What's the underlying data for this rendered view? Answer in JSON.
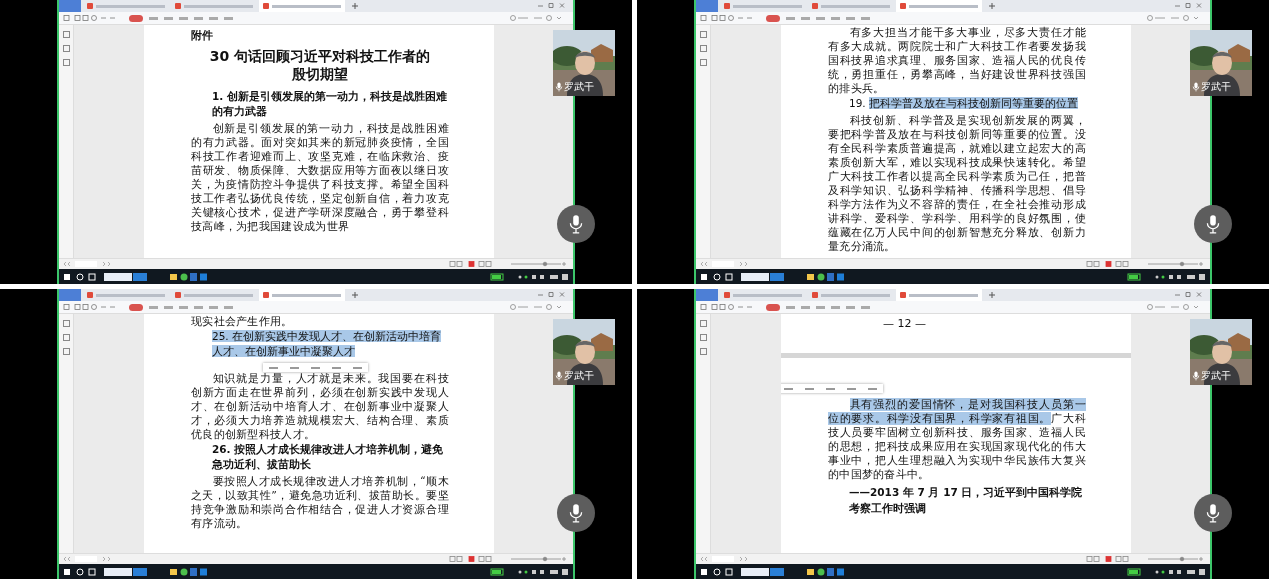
{
  "panels": [
    {
      "tabs": [
        {
          "selected": false
        },
        {
          "selected": false
        },
        {
          "selected": true
        }
      ],
      "ribbon": [
        {
          "selected": true
        },
        {
          "selected": false
        },
        {
          "selected": false
        },
        {
          "selected": false
        },
        {
          "selected": false
        },
        {
          "selected": false
        },
        {
          "selected": false
        }
      ],
      "speaker": "罗武干",
      "blocks": [
        {
          "kind": "label",
          "text": "附件"
        },
        {
          "kind": "title",
          "lines": [
            "30 句话回顾习近平对科技工作者的",
            "殷切期望"
          ]
        },
        {
          "kind": "heading",
          "bold": true,
          "segments": [
            {
              "text": "1.  创新是引领发展的第一动力，科技是战胜困难的有力武器",
              "selected": false
            }
          ]
        },
        {
          "kind": "paragraph",
          "segments": [
            {
              "text": "创新是引领发展的第一动力，科技是战胜困难的有力武器。面对突如其来的新冠肺炎疫情，全国科技工作者迎难而上、攻坚克难，在临床救治、疫苗研发、物质保障、大数据应用等方面夜以继日攻关，为疫情防控斗争提供了科技支撑。希望全国科技工作者弘扬优良传统，坚定创新自信，着力攻克关键核心技术，促进产学研深度融合，勇于攀登科技高峰，为把我国建设成为世界",
              "selected": false
            }
          ]
        }
      ]
    },
    {
      "tabs": [
        {
          "selected": false
        },
        {
          "selected": false
        },
        {
          "selected": true
        }
      ],
      "ribbon": [
        {
          "selected": true
        },
        {
          "selected": false
        },
        {
          "selected": false
        },
        {
          "selected": false
        },
        {
          "selected": false
        },
        {
          "selected": false
        },
        {
          "selected": false
        }
      ],
      "speaker": "罗武干",
      "blocks": [
        {
          "kind": "paragraph",
          "segments": [
            {
              "text": "有多大担当才能干多大事业，尽多大责任才能有多大成就。两院院士和广大科技工作者要发扬我国科技界追求真理、服务国家、造福人民的优良传统，勇担重任，勇攀高峰，当好建设世界科技强国的排头兵。",
              "selected": false
            }
          ]
        },
        {
          "kind": "heading",
          "bold": false,
          "segments": [
            {
              "text": "19.  ",
              "selected": false
            },
            {
              "text": "把科学普及放在与科技创新同等重要的位置",
              "selected": true
            }
          ]
        },
        {
          "kind": "paragraph",
          "segments": [
            {
              "text": "科技创新、科学普及是实现创新发展的两翼，要把科学普及放在与科技创新同等重要的位置。没有全民科学素质普遍提高，就难以建立起宏大的高素质创新大军，难以实现科技成果快速转化。希望广大科技工作者以提高全民科学素质为己任，把普及科学知识、弘扬科学精神、传播科学思想、倡导科学方法作为义不容辞的责任，在全社会推动形成讲科学、爱科学、学科学、用科学的良好氛围，使蕴藏在亿万人民中间的创新智慧充分释放、创新力量充分涌流。",
              "selected": false
            }
          ]
        }
      ]
    },
    {
      "tabs": [
        {
          "selected": false
        },
        {
          "selected": false
        },
        {
          "selected": true
        }
      ],
      "ribbon": [
        {
          "selected": true
        },
        {
          "selected": false
        },
        {
          "selected": false
        },
        {
          "selected": false
        },
        {
          "selected": false
        },
        {
          "selected": false
        },
        {
          "selected": false
        }
      ],
      "speaker": "罗武干",
      "blocks": [
        {
          "kind": "paragraph",
          "segments": [
            {
              "text": "现实社会产生作用。",
              "selected": false
            }
          ],
          "noindent": true
        },
        {
          "kind": "heading",
          "bold": false,
          "menu": true,
          "segments": [
            {
              "text": "25.  在创新实践中发现人才、在创新活动中培育人才、在创新事业中凝聚人才",
              "selected": true
            }
          ]
        },
        {
          "kind": "paragraph",
          "segments": [
            {
              "text": "知识就是力量，人才就是未来。我国要在科技创新方面走在世界前列，必须在创新实践中发现人才、在创新活动中培育人才、在创新事业中凝聚人才，必须大力培养造就规模宏大、结构合理、素质优良的创新型科技人才。",
              "selected": false
            }
          ]
        },
        {
          "kind": "heading",
          "bold": true,
          "segments": [
            {
              "text": "26.  按照人才成长规律改进人才培养机制，避免急功近利、拔苗助长",
              "selected": false
            }
          ]
        },
        {
          "kind": "paragraph",
          "segments": [
            {
              "text": "要按照人才成长规律改进人才培养机制，“顺木之天，以致其性”，避免急功近利、拔苗助长。要坚持竞争激励和崇尚合作相结合，促进人才资源合理有序流动。",
              "selected": false
            }
          ]
        }
      ]
    },
    {
      "tabs": [
        {
          "selected": false
        },
        {
          "selected": false
        },
        {
          "selected": true
        }
      ],
      "ribbon": [
        {
          "selected": true
        },
        {
          "selected": false
        },
        {
          "selected": false
        },
        {
          "selected": false
        },
        {
          "selected": false
        },
        {
          "selected": false
        },
        {
          "selected": false
        }
      ],
      "speaker": "罗武干",
      "blocks": [
        {
          "kind": "page-number",
          "text": "— 12 —"
        },
        {
          "kind": "page-break"
        },
        {
          "kind": "paragraph",
          "menu": true,
          "segments": [
            {
              "text": "具有强烈的爱国情怀，是对我国科技人员第一位的要求。科学没有国界，科学家有祖国。",
              "selected": true
            },
            {
              "text": "广大科技人员要牢固树立创新科技、服务国家、造福人民的思想，把科技成果应用在实现国家现代化的伟大事业中，把人生理想融入为实现中华民族伟大复兴的中国梦的奋斗中。",
              "selected": false
            }
          ]
        },
        {
          "kind": "attribution",
          "text": "——2013 年 7 月 17 日，习近平到中国科学院考察工作时强调"
        }
      ]
    }
  ]
}
